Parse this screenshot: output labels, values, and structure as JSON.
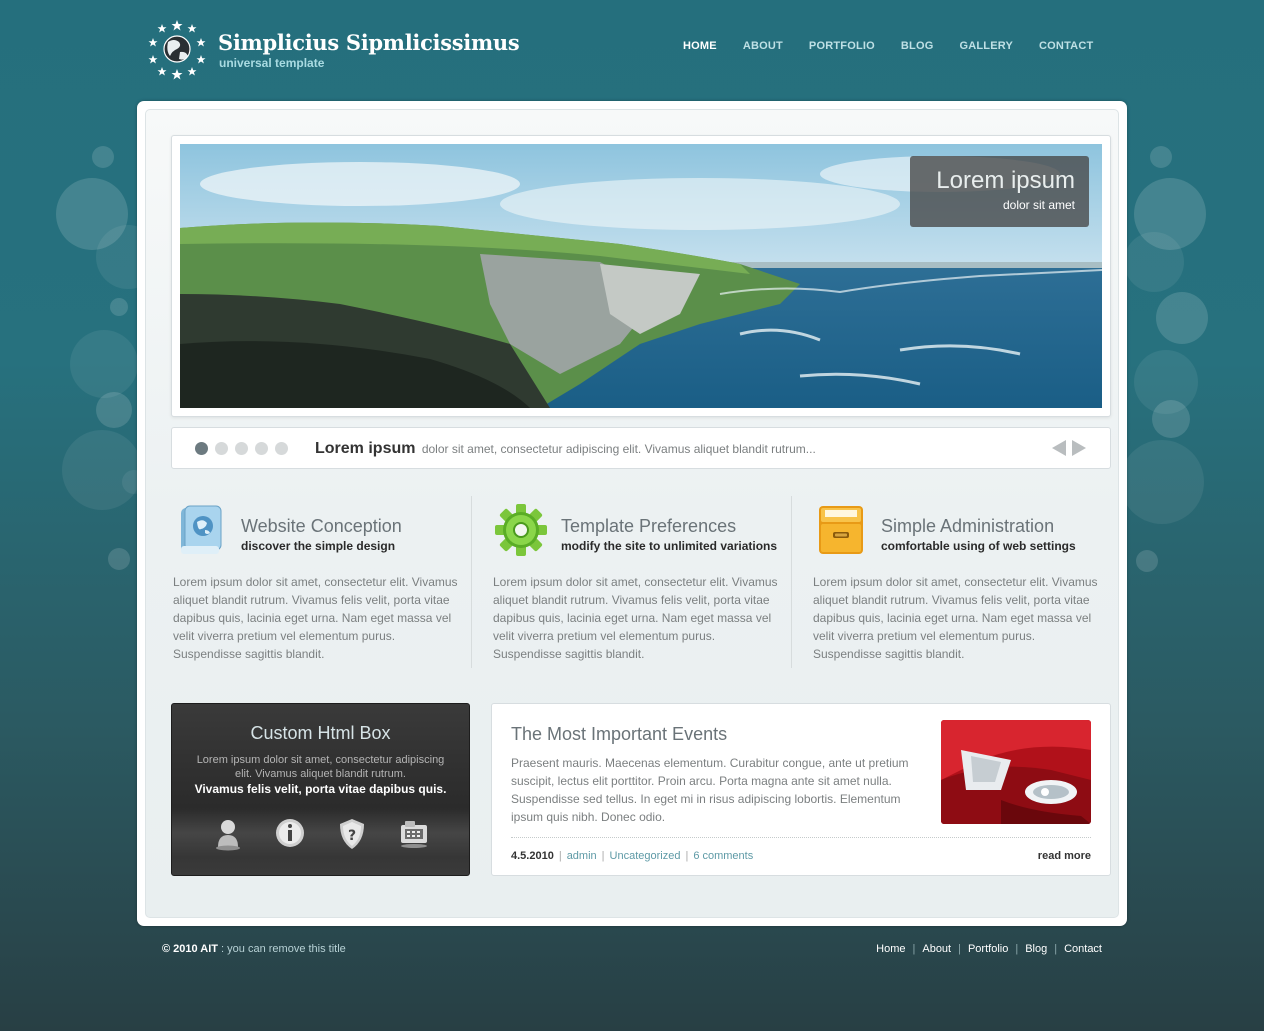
{
  "site": {
    "title": "Simplicius Sipmlicissimus",
    "subtitle": "universal template"
  },
  "nav": {
    "items": [
      "HOME",
      "ABOUT",
      "PORTFOLIO",
      "BLOG",
      "GALLERY",
      "CONTACT"
    ],
    "active": "HOME"
  },
  "slider": {
    "caption_title": "Lorem ipsum",
    "caption_sub": "dolor sit amet",
    "bar_title": "Lorem ipsum",
    "bar_text": "dolor sit amet, consectetur adipiscing elit. Vivamus aliquet blandit rutrum...",
    "dot_count": 5,
    "active_dot": 1
  },
  "features": [
    {
      "icon": "book-globe-icon",
      "title": "Website Conception",
      "subtitle": "discover the simple design",
      "text": "Lorem ipsum dolor sit amet, consectetur elit. Vivamus aliquet blandit rutrum. Vivamus felis velit, porta vitae dapibus quis, lacinia eget urna. Nam eget massa vel velit viverra pretium vel elementum purus. Suspendisse sagittis blandit."
    },
    {
      "icon": "gear-icon",
      "title": "Template Preferences",
      "subtitle": "modify the site to unlimited variations",
      "text": "Lorem ipsum dolor sit amet, consectetur elit. Vivamus aliquet blandit rutrum. Vivamus felis velit, porta vitae dapibus quis, lacinia eget urna. Nam eget massa vel velit viverra pretium vel elementum purus. Suspendisse sagittis blandit."
    },
    {
      "icon": "file-drawer-icon",
      "title": "Simple Administration",
      "subtitle": "comfortable using of web settings",
      "text": "Lorem ipsum dolor sit amet, consectetur elit. Vivamus aliquet blandit rutrum. Vivamus felis velit, porta vitae dapibus quis, lacinia eget urna. Nam eget massa vel velit viverra pretium vel elementum purus. Suspendisse sagittis blandit."
    }
  ],
  "custom_box": {
    "title": "Custom Html Box",
    "text": "Lorem ipsum dolor sit amet, consectetur adipiscing elit. Vivamus aliquet blandit rutrum.",
    "bold": "Vivamus felis velit, porta vitae dapibus quis.",
    "icons": [
      "user-icon",
      "info-icon",
      "shield-icon",
      "phone-icon"
    ]
  },
  "events": {
    "title": "The Most Important Events",
    "text": "Praesent mauris. Maecenas elementum. Curabitur congue, ante ut pretium suscipit, lectus elit porttitor. Proin arcu. Porta magna ante sit amet nulla. Suspendisse sed tellus. In eget mi in risus adipiscing lobortis. Elementum ipsum quis nibh. Donec odio.",
    "date": "4.5.2010",
    "author": "admin",
    "category": "Uncategorized",
    "comments": "6 comments",
    "read_more": "read more"
  },
  "footer": {
    "copyright": "© 2010 AIT",
    "note": " : you can remove this title",
    "links": [
      "Home",
      "About",
      "Portfolio",
      "Blog",
      "Contact"
    ]
  },
  "colors": {
    "background_top": "#256f7d",
    "background_bottom": "#283f44",
    "accent": "#5e9aa6"
  }
}
